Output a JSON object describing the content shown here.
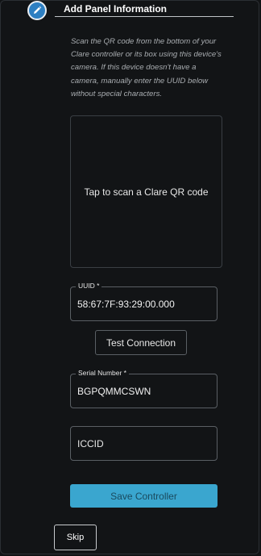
{
  "header": {
    "title": "Add Panel Information",
    "icon": "pencil-icon",
    "accent_color": "#2d7fc2"
  },
  "instructions": "Scan the QR code from the bottom of your Clare controller or its box using this device's camera. If this device doesn't have a camera, manually enter the UUID below without special characters.",
  "scanner": {
    "label": "Tap to scan a Clare QR code"
  },
  "uuid_field": {
    "label": "UUID *",
    "value": "58:67:7F:93:29:00.000"
  },
  "test_button": {
    "label": "Test Connection"
  },
  "serial_field": {
    "label": "Serial Number *",
    "value": "BGPQMMCSWN"
  },
  "iccid_field": {
    "placeholder": "ICCID"
  },
  "save_button": {
    "label": "Save Controller",
    "color": "#3aa6cf"
  },
  "skip_button": {
    "label": "Skip"
  }
}
